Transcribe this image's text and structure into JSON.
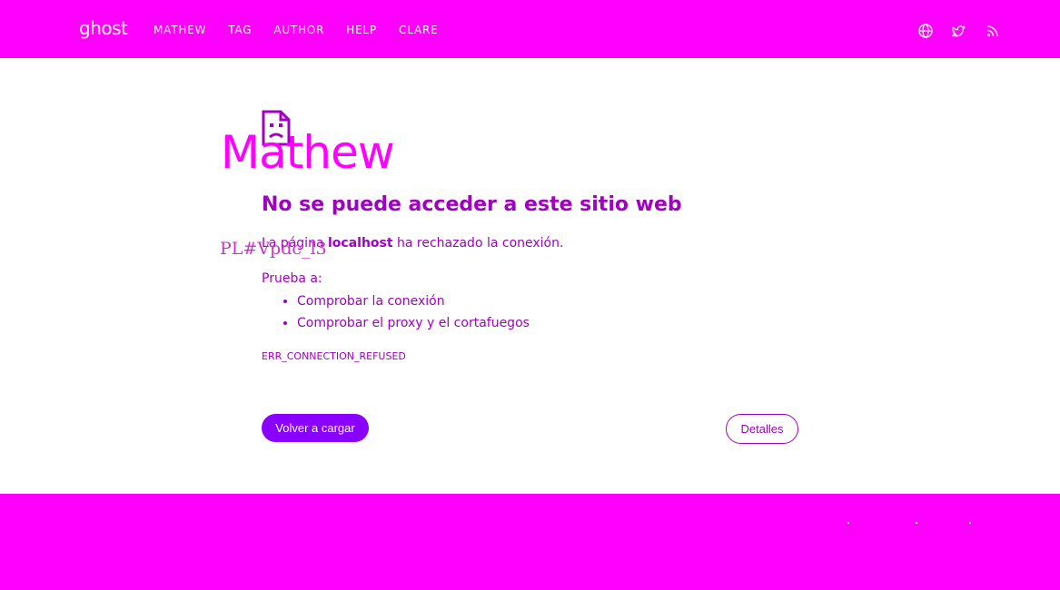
{
  "header": {
    "brand": "ghost",
    "nav": [
      "MATHEW",
      "TAG",
      "AUTHOR",
      "HELP",
      "CLARE"
    ],
    "social_icons": [
      "globe-icon",
      "twitter-icon",
      "rss-icon"
    ]
  },
  "post": {
    "title": "Mathew",
    "glitch_text": "PL#Vpdc_l3"
  },
  "error_page": {
    "icon": "sad-page-icon",
    "heading": "No se puede acceder a este sitio web",
    "description_prefix": "La página ",
    "description_host": "localhost",
    "description_suffix": " ha rechazado la conexión.",
    "try_label": "Prueba a:",
    "suggestions": [
      "Comprobar la conexión",
      "Comprobar el proxy y el cortafuegos"
    ],
    "error_code": "ERR_CONNECTION_REFUSED",
    "reload_button": "Volver a cargar",
    "details_button": "Detalles"
  },
  "colors": {
    "header_bg": "#ff00ff",
    "footer_bg": "#ff00ff",
    "text_purple": "#a000c0",
    "button_purple": "#8a00ff"
  }
}
